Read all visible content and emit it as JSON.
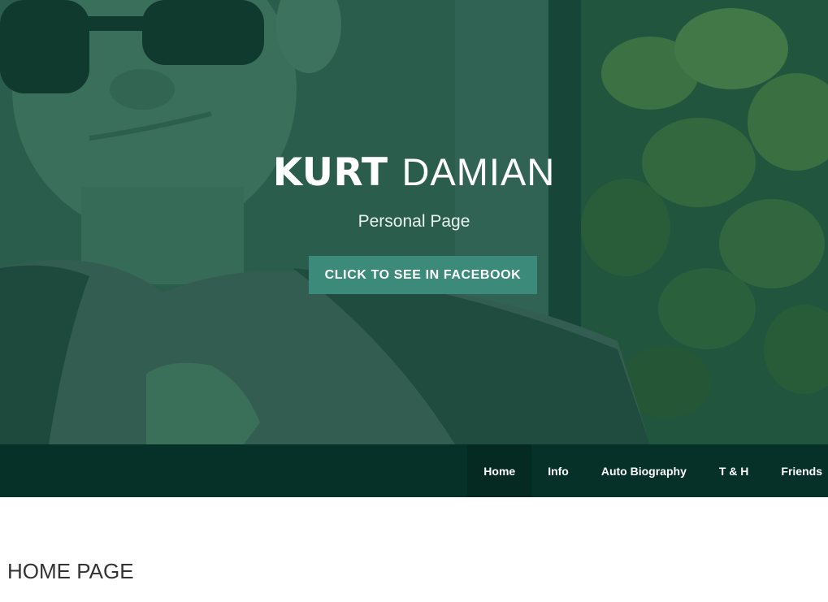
{
  "hero": {
    "title_first": "KURT",
    "title_last": "DAMIAN",
    "subtitle": "Personal Page",
    "button_label": "CLICK TO SEE IN FACEBOOK"
  },
  "nav": {
    "items": [
      {
        "label": "Home",
        "active": true
      },
      {
        "label": "Info",
        "active": false
      },
      {
        "label": "Auto Biography",
        "active": false
      },
      {
        "label": "T & H",
        "active": false
      },
      {
        "label": "Friends",
        "active": false
      }
    ]
  },
  "main": {
    "heading": "HOME PAGE"
  },
  "colors": {
    "overlay": "#124e3c",
    "button": "#3c8a79",
    "navbar": "#063128",
    "nav_active": "#052a22"
  }
}
